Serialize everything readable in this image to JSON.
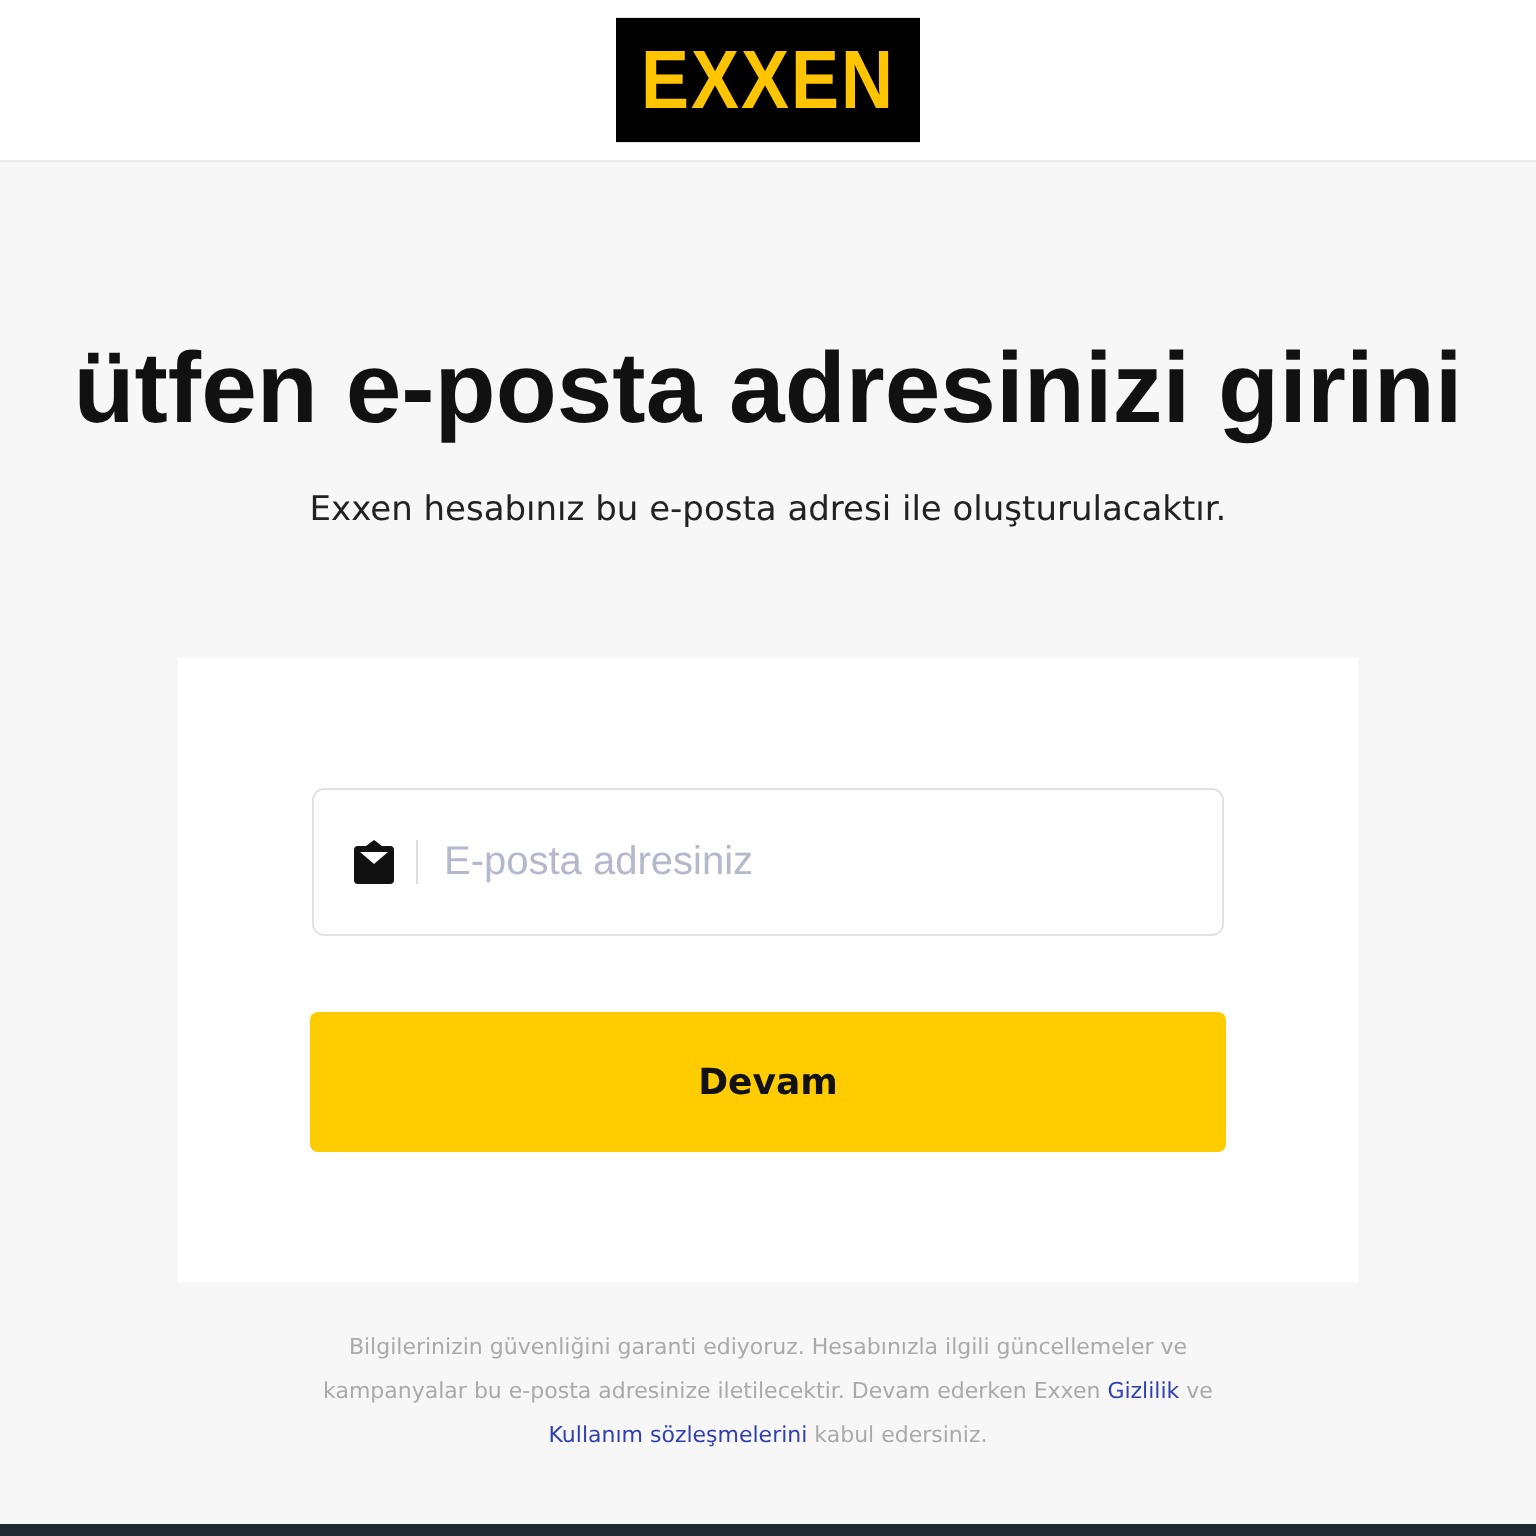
{
  "header": {
    "logo": "EXXEN"
  },
  "heading": "ütfen e-posta adresinizi girini",
  "subheading": "Exxen hesabınız bu e-posta adresi ile oluşturulacaktır.",
  "form": {
    "email": {
      "placeholder": "E-posta adresiniz"
    },
    "button": "Devam"
  },
  "notice": {
    "text": "Bilgilerinizin güvenliğini garanti ediyoruz. Hesabınızla ilgili güncellemeler ve kampanyalar bu e-posta adresinize iletilecektir. Devam ederken Exxen",
    "privacy_link": "Gizlilik",
    "middle": "ve",
    "terms_link": "Kullanım sözleşmelerini",
    "end": "kabul edersiniz."
  }
}
